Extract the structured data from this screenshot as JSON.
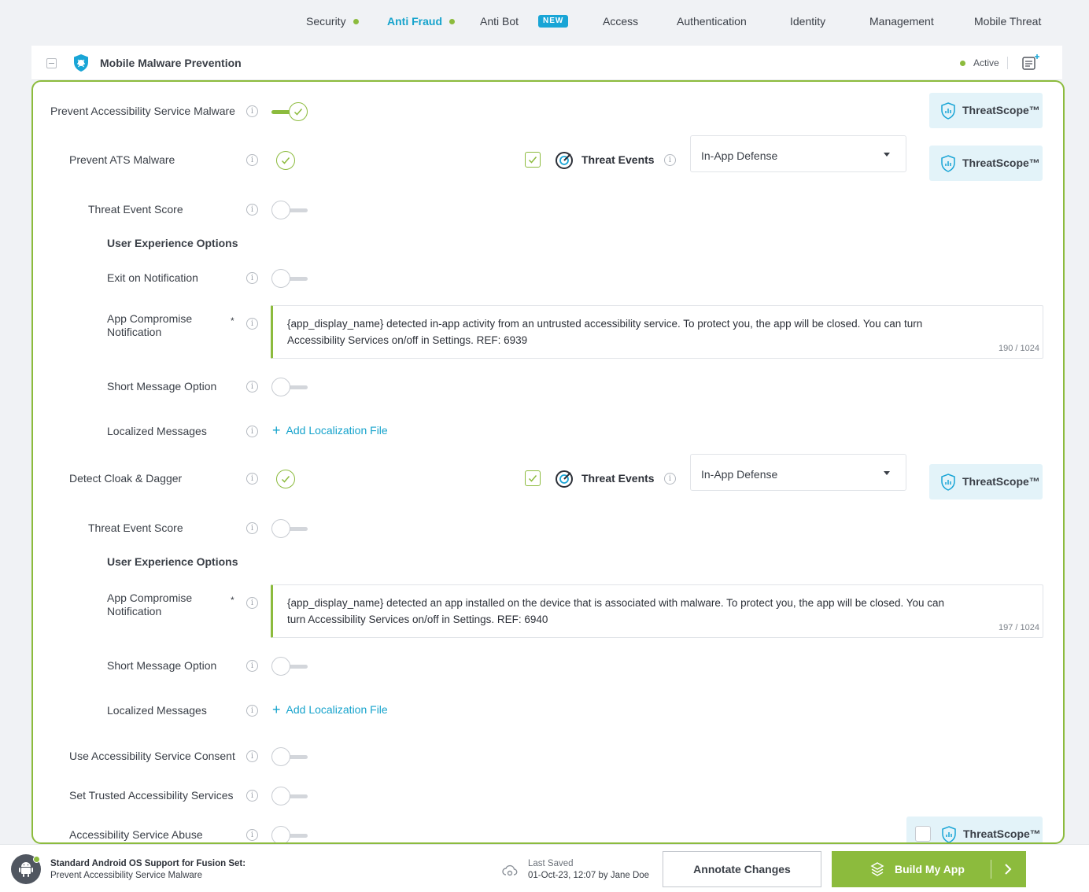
{
  "nav": {
    "tabs": [
      {
        "label": "Security",
        "dot": true
      },
      {
        "label": "Anti Fraud",
        "dot": true,
        "active": true
      },
      {
        "label": "Anti Bot",
        "badge": "NEW"
      },
      {
        "label": "Access"
      },
      {
        "label": "Authentication"
      },
      {
        "label": "Identity"
      },
      {
        "label": "Management"
      },
      {
        "label": "Mobile Threat"
      }
    ]
  },
  "panel": {
    "title": "Mobile Malware Prevention",
    "status": "Active"
  },
  "threatscope_label": "ThreatScope™",
  "threat_events_label": "Threat Events",
  "add_localization_label": "Add Localization File",
  "rows": {
    "prevent_accessibility": "Prevent Accessibility Service Malware",
    "prevent_ats": "Prevent ATS Malware",
    "threat_event_score_1": "Threat Event Score",
    "ux_options_1": "User Experience Options",
    "exit_on_notification": "Exit on Notification",
    "app_compromise_1": "App Compromise Notification",
    "short_message_1": "Short Message Option",
    "localized_1": "Localized Messages",
    "detect_cloak": "Detect Cloak & Dagger",
    "threat_event_score_2": "Threat Event Score",
    "ux_options_2": "User Experience Options",
    "app_compromise_2": "App Compromise Notification",
    "short_message_2": "Short Message Option",
    "localized_2": "Localized Messages",
    "use_consent": "Use Accessibility Service Consent",
    "set_trusted": "Set Trusted Accessibility Services",
    "service_abuse": "Accessibility Service Abuse"
  },
  "selects": {
    "ats_defense": "In-App Defense",
    "cloak_defense": "In-App Defense"
  },
  "messages": {
    "msg1": {
      "text": "{app_display_name} detected in-app activity from an untrusted accessibility service. To protect you, the app will be closed. You can turn Accessibility Services on/off in Settings. REF: 6939",
      "counter": "190 / 1024"
    },
    "msg2": {
      "text": "{app_display_name} detected an app installed on the device that is associated with malware. To protect you, the app will be closed. You can turn Accessibility Services on/off in Settings. REF: 6940",
      "counter": "197 / 1024"
    }
  },
  "footer": {
    "title": "Standard Android OS Support for Fusion Set:",
    "subtitle": "Prevent Accessibility Service Malware",
    "last_saved_label": "Last Saved",
    "last_saved_value": "01-Oct-23, 12:07 by Jane Doe",
    "annotate_label": "Annotate Changes",
    "build_label": "Build My App"
  },
  "colors": {
    "accent_green": "#8cbb3d",
    "accent_blue": "#16a3cc",
    "threatscope_bg": "#e3f3f9"
  }
}
